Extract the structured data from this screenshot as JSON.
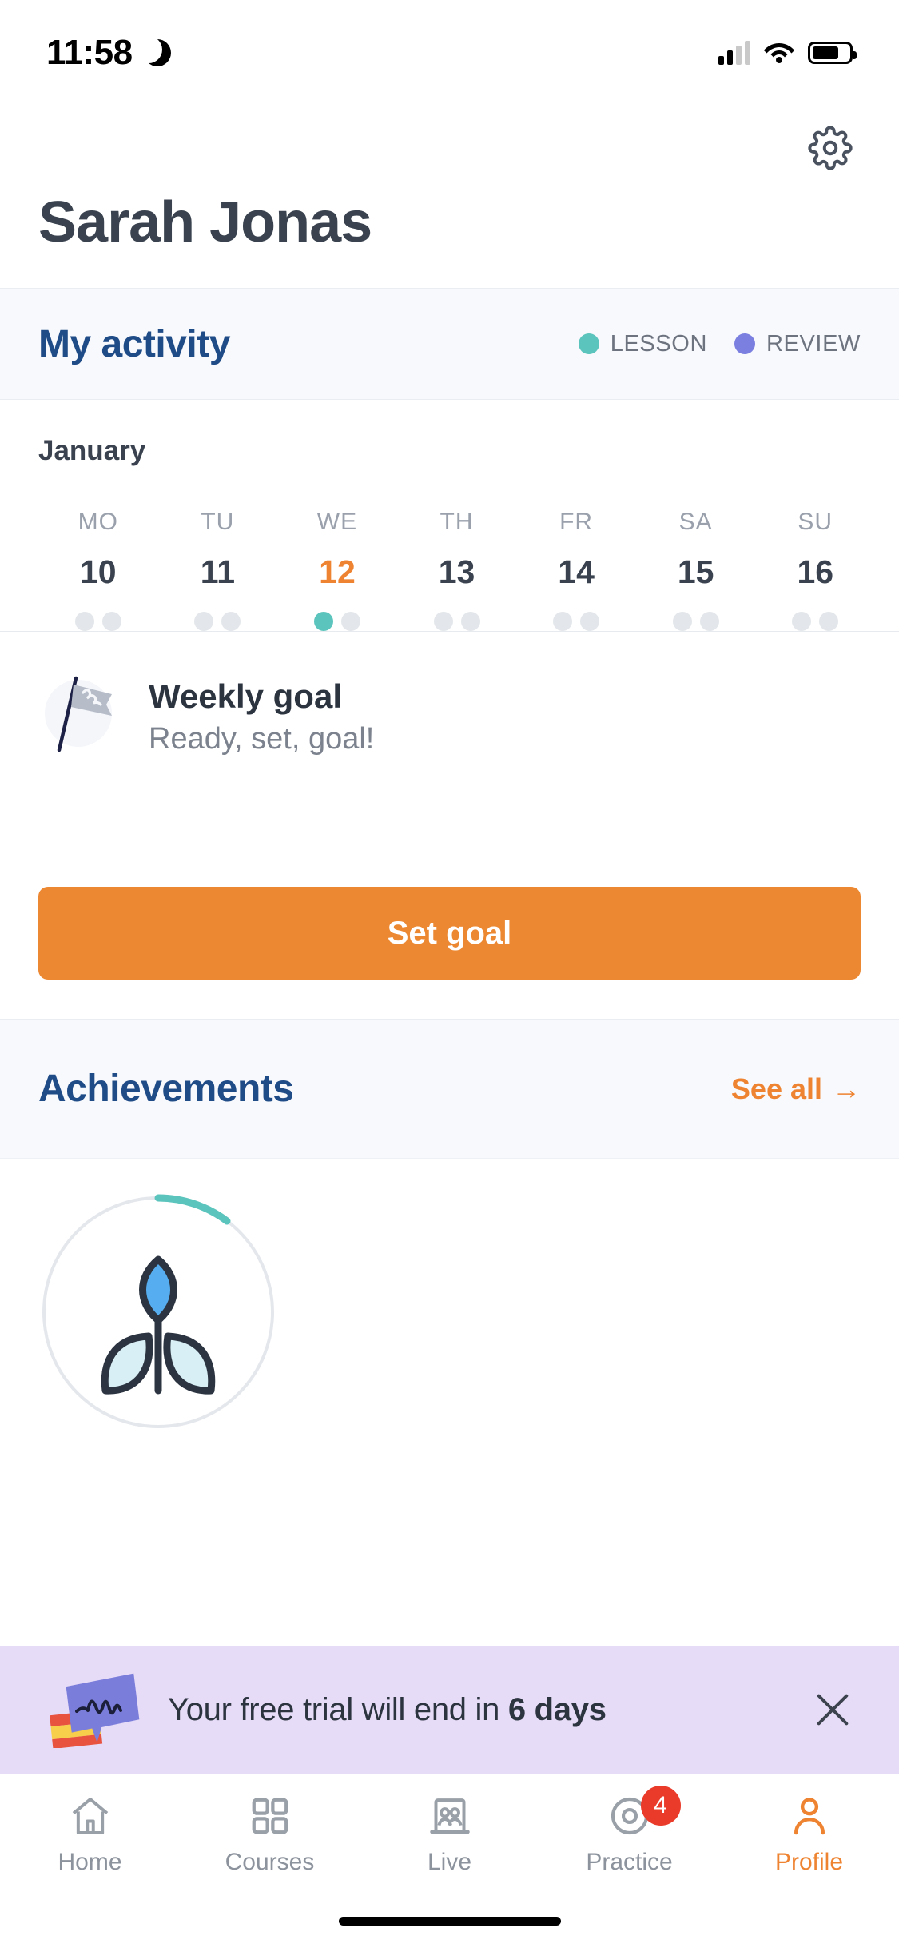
{
  "status_bar": {
    "time": "11:58",
    "dnd_icon": "moon-icon",
    "signal_icon": "cellular-signal-icon",
    "wifi_icon": "wifi-icon",
    "battery_icon": "battery-icon"
  },
  "header": {
    "settings_icon": "gear-icon",
    "user_name": "Sarah Jonas"
  },
  "activity": {
    "title": "My activity",
    "legend": [
      {
        "label": "LESSON",
        "color": "#5bc4bc",
        "key": "lesson"
      },
      {
        "label": "REVIEW",
        "color": "#7b7fe0",
        "key": "review"
      }
    ],
    "month": "January",
    "days": [
      {
        "dow": "MO",
        "date": "10",
        "today": false,
        "dots": [
          "empty",
          "empty"
        ]
      },
      {
        "dow": "TU",
        "date": "11",
        "today": false,
        "dots": [
          "empty",
          "empty"
        ]
      },
      {
        "dow": "WE",
        "date": "12",
        "today": true,
        "dots": [
          "lesson",
          "empty"
        ]
      },
      {
        "dow": "TH",
        "date": "13",
        "today": false,
        "dots": [
          "empty",
          "empty"
        ]
      },
      {
        "dow": "FR",
        "date": "14",
        "today": false,
        "dots": [
          "empty",
          "empty"
        ]
      },
      {
        "dow": "SA",
        "date": "15",
        "today": false,
        "dots": [
          "empty",
          "empty"
        ]
      },
      {
        "dow": "SU",
        "date": "16",
        "today": false,
        "dots": [
          "empty",
          "empty"
        ]
      }
    ]
  },
  "weekly_goal": {
    "icon": "flag-icon",
    "title": "Weekly goal",
    "subtitle": "Ready, set, goal!",
    "button_label": "Set goal"
  },
  "achievements": {
    "title": "Achievements",
    "see_all_label": "See all",
    "see_all_arrow": "→",
    "badge_icon": "plant-sprout-icon",
    "badge_progress_percent": 8
  },
  "trial_banner": {
    "icon": "speech-bubble-spanish-flag-icon",
    "text_prefix": "Your free trial will end in ",
    "text_emphasis": "6 days",
    "close_icon": "close-icon"
  },
  "bottom_nav": {
    "items": [
      {
        "label": "Home",
        "icon": "home-icon",
        "active": false,
        "badge": null
      },
      {
        "label": "Courses",
        "icon": "grid-icon",
        "active": false,
        "badge": null
      },
      {
        "label": "Live",
        "icon": "people-icon",
        "active": false,
        "badge": null
      },
      {
        "label": "Practice",
        "icon": "target-icon",
        "active": false,
        "badge": "4"
      },
      {
        "label": "Profile",
        "icon": "person-icon",
        "active": true,
        "badge": null
      }
    ]
  },
  "colors": {
    "accent_orange": "#ee8432",
    "navy": "#1f4b87",
    "teal": "#5bc4bc",
    "review_purple": "#7b7fe0",
    "banner_lavender": "#e6dcf7",
    "badge_red": "#ea3b2a"
  }
}
